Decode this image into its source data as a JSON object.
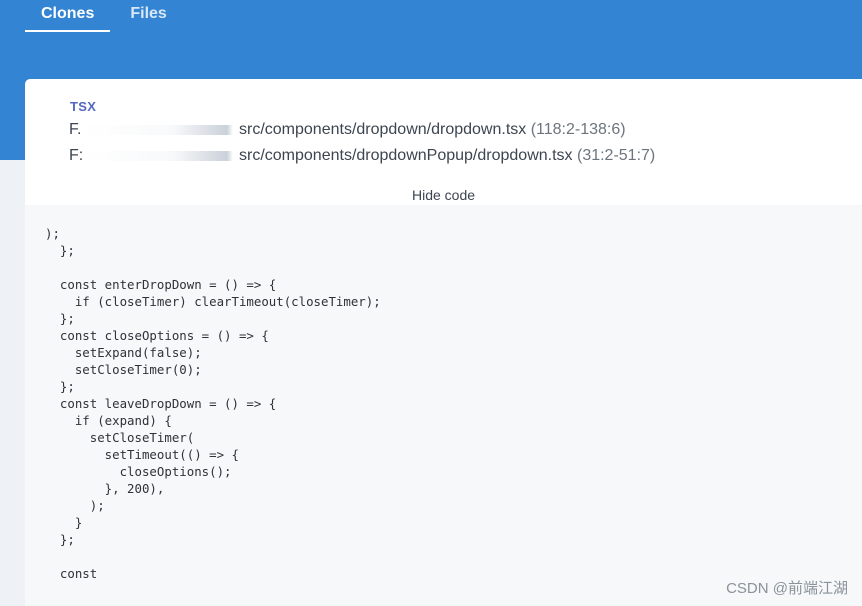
{
  "tabs": [
    {
      "label": "Clones",
      "active": true
    },
    {
      "label": "Files",
      "active": false
    }
  ],
  "card": {
    "language": "TSX",
    "files": [
      {
        "drive": "F.",
        "path": "src/components/dropdown/dropdown.tsx",
        "range": "(118:2-138:6)"
      },
      {
        "drive": "F:",
        "path": "src/components/dropdownPopup/dropdown.tsx",
        "range": "(31:2-51:7)"
      }
    ],
    "hide_code_label": "Hide code"
  },
  "code": {
    "text": ");\n  };\n\n  const enterDropDown = () => {\n    if (closeTimer) clearTimeout(closeTimer);\n  };\n  const closeOptions = () => {\n    setExpand(false);\n    setCloseTimer(0);\n  };\n  const leaveDropDown = () => {\n    if (expand) {\n      setCloseTimer(\n        setTimeout(() => {\n          closeOptions();\n        }, 200),\n      );\n    }\n  };\n\n  const"
  },
  "watermark": "CSDN @前端江湖",
  "colors": {
    "header_bg": "#3384d3",
    "lang_accent": "#5468c0",
    "code_bg": "#f6f8fa"
  }
}
